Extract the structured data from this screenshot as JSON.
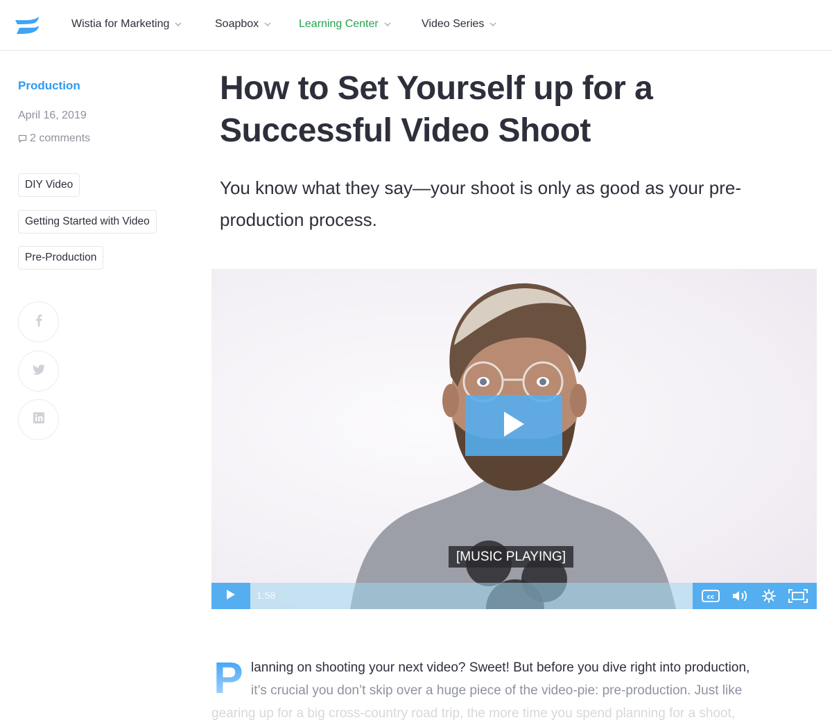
{
  "brand": {
    "logo_icon": "wistia-logo-icon",
    "accent_color": "#2c9af2",
    "active_nav_color": "#23a24d",
    "player_color": "#54aef0"
  },
  "nav": {
    "items": [
      {
        "label": "Wistia for Marketing",
        "active": false,
        "icon": "chevron-down-icon"
      },
      {
        "label": "Soapbox",
        "active": false,
        "icon": "chevron-down-icon"
      },
      {
        "label": "Learning Center",
        "active": true,
        "icon": "chevron-down-icon"
      },
      {
        "label": "Video Series",
        "active": false,
        "icon": "chevron-down-icon"
      }
    ]
  },
  "sidebar": {
    "category": "Production",
    "date": "April 16, 2019",
    "comments_icon": "comment-icon",
    "comments": "2 comments",
    "tags": [
      "DIY Video",
      "Getting Started with Video",
      "Pre-Production"
    ],
    "share": [
      {
        "network": "Facebook",
        "icon": "facebook-icon"
      },
      {
        "network": "Twitter",
        "icon": "twitter-icon"
      },
      {
        "network": "LinkedIn",
        "icon": "linkedin-icon"
      }
    ]
  },
  "article": {
    "title": "How to Set Yourself up for a Successful Video Shoot",
    "dek": "You know what they say—your shoot is only as good as your pre-production process.",
    "dropcap": "P",
    "body_lines": [
      "lanning on shooting your next video? Sweet! But before you dive right into production,",
      "it’s crucial you don’t skip over a huge piece of the video-pie: pre-production. Just like",
      "gearing up for a big cross-country road trip, the more time you spend planning for a shoot,"
    ]
  },
  "video": {
    "caption": "[MUSIC PLAYING]",
    "duration": "1:58",
    "controls": {
      "big_play_icon": "play-icon",
      "play_icon": "play-icon",
      "cc_icon": "closed-captions-icon",
      "volume_icon": "volume-icon",
      "settings_icon": "settings-gear-icon",
      "fullscreen_icon": "fullscreen-icon"
    }
  }
}
